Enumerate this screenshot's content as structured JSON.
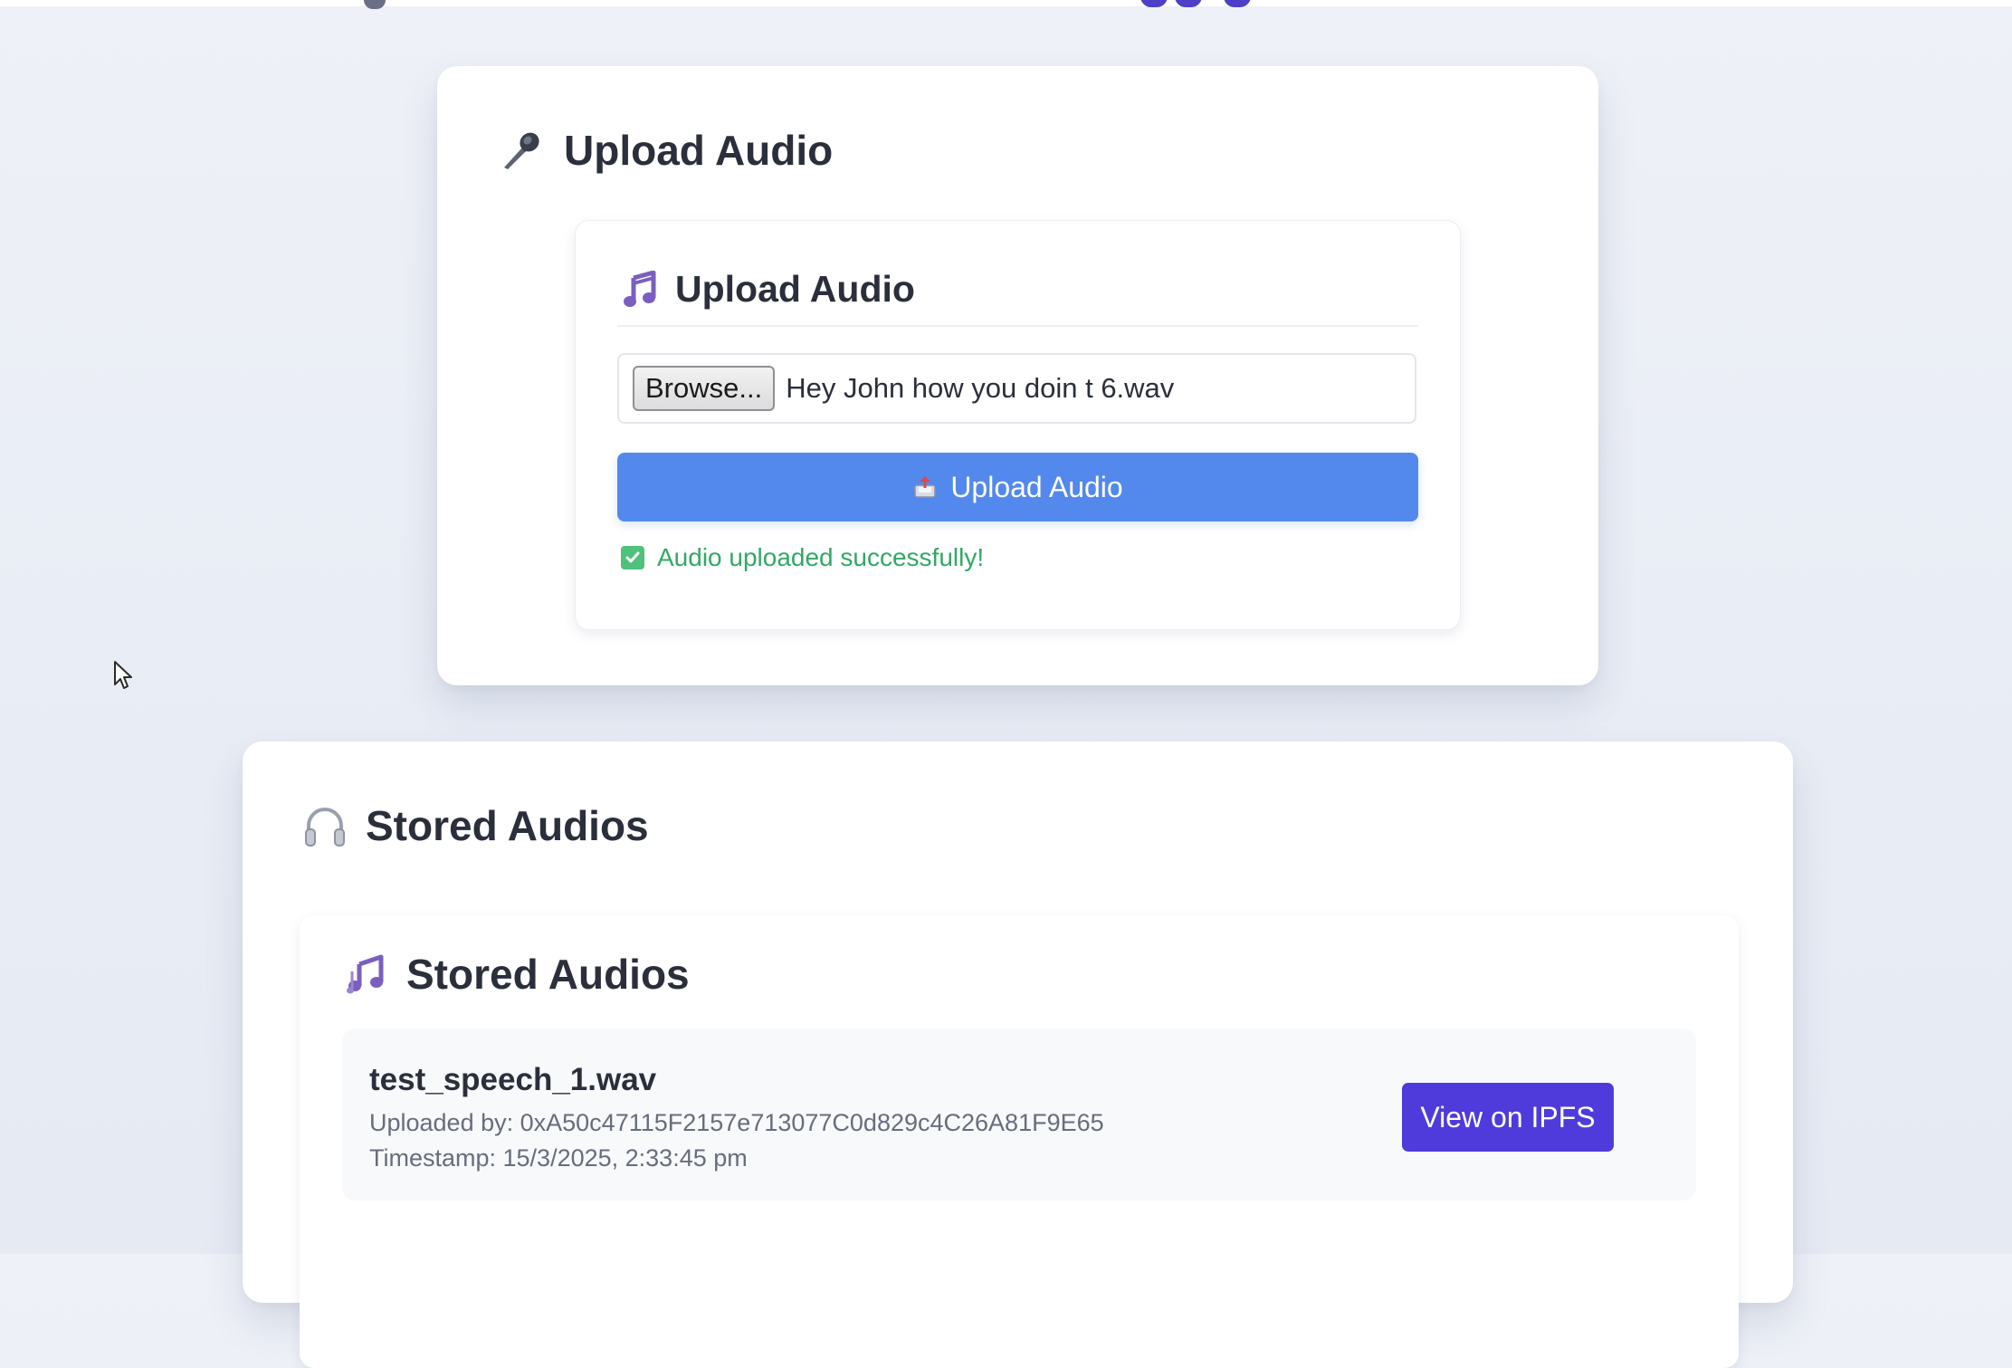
{
  "upload_section": {
    "title": "Upload Audio",
    "icon": "microphone-icon",
    "form": {
      "title": "Upload Audio",
      "icon": "music-note-icon",
      "browse_label": "Browse...",
      "file_name": "Hey John how you doin t 6.wav",
      "upload_button_label": "Upload Audio",
      "upload_button_icon": "outbox-tray-icon",
      "status_message": "Audio uploaded successfully!",
      "status_icon": "check-box-icon"
    }
  },
  "stored_section": {
    "title": "Stored Audios",
    "icon": "headphones-icon",
    "list": {
      "title": "Stored Audios",
      "icon": "music-notes-icon",
      "items": [
        {
          "name": "test_speech_1.wav",
          "uploaded_by": "Uploaded by: 0xA50c47115F2157e713077C0d829c4C26A81F9E65",
          "timestamp": "Timestamp: 15/3/2025, 2:33:45 pm",
          "action_label": "View on IPFS"
        }
      ]
    }
  },
  "colors": {
    "primary_button": "#5389ec",
    "ipfs_button": "#4f3bdb",
    "success": "#32a866",
    "background": "#eef1f7"
  }
}
